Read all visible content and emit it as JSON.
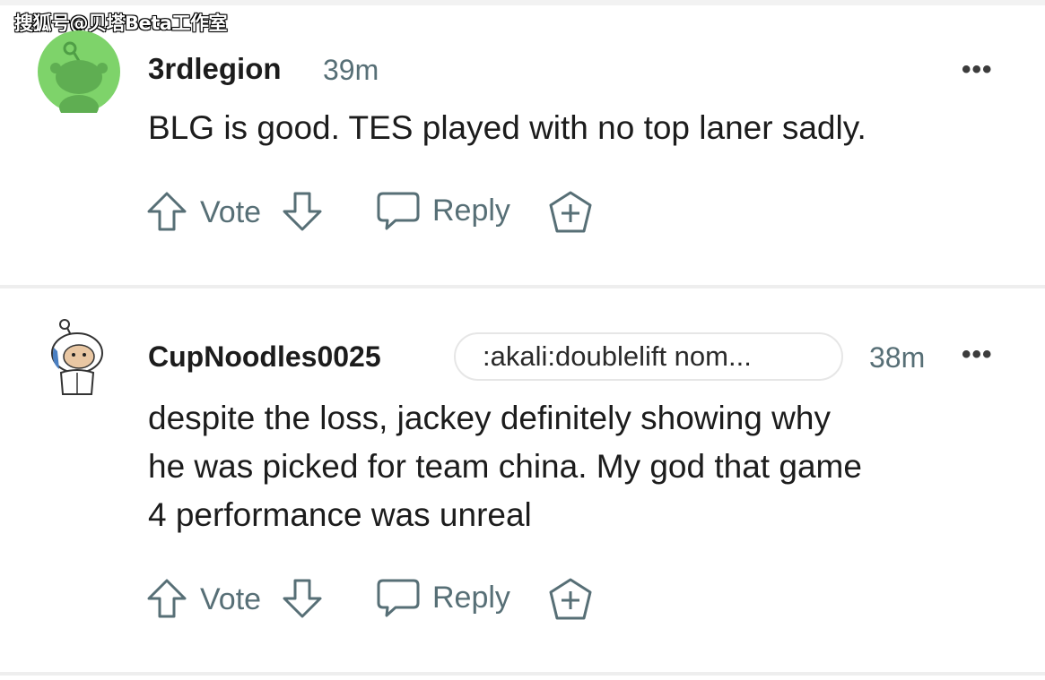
{
  "watermark": "搜狐号@贝塔Beta工作室",
  "comments": [
    {
      "username": "3rdlegion",
      "time": "39m",
      "body": "BLG is good. TES played with no top laner sadly.",
      "actions": {
        "vote": "Vote",
        "reply": "Reply"
      }
    },
    {
      "username": "CupNoodles0025",
      "flair": ":akali:doublelift nom...",
      "time": "38m",
      "body_lines": [
        "despite the loss, jackey definitely showing why",
        "he was picked for team china. My god that game",
        "4 performance was unreal"
      ],
      "actions": {
        "vote": "Vote",
        "reply": "Reply"
      }
    }
  ],
  "more_glyph": "•••",
  "colors": {
    "meta": "#576f76",
    "avatar_green": "#7ed36a",
    "divider": "#eeeeee"
  }
}
